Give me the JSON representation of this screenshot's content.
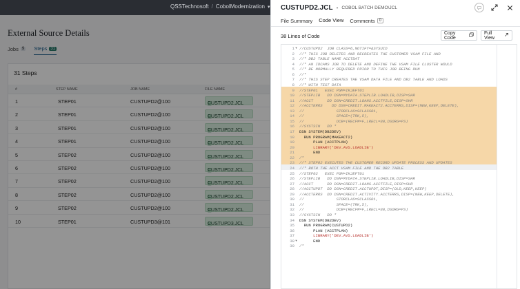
{
  "app": {
    "org": "QSSTechnosoft",
    "project": "CobolModernization"
  },
  "page": {
    "title": "External Source Details",
    "tabs": [
      {
        "label": "Jobs",
        "count": "9"
      },
      {
        "label": "Steps",
        "count": "31"
      }
    ],
    "steps_count_label": "31 Steps",
    "columns": [
      "#",
      "STEP NAME",
      "JOB NAME",
      "FILE NAME"
    ],
    "rows": [
      [
        "1",
        "STEP01",
        "CUSTUPD2@100",
        "CUSTUPD2.JCL"
      ],
      [
        "2",
        "STEP01",
        "CUSTUPD2@100",
        "CUSTUPD2.JCL"
      ],
      [
        "3",
        "STEP01",
        "CUSTUPD2@100",
        "CUSTUPD2.JCL"
      ],
      [
        "4",
        "STEP01",
        "CUSTUPD2@100",
        "CUSTUPD2.JCL"
      ],
      [
        "5",
        "STEP02",
        "CUSTUPD2@100",
        "CUSTUPD2.JCL"
      ],
      [
        "6",
        "STEP02",
        "CUSTUPD2@100",
        "CUSTUPD2.JCL"
      ],
      [
        "7",
        "STEP02",
        "CUSTUPD2@100",
        "CUSTUPD2.JCL"
      ],
      [
        "8",
        "STEP02",
        "CUSTUPD2@100",
        "CUSTUPD2.JCL"
      ],
      [
        "9",
        "STEP02",
        "CUSTUPD2@100",
        "CUSTUPD2.JCL"
      ],
      [
        "10",
        "STEP01",
        "CUSTUPD3@101",
        "CUSTUPD3.JCL"
      ]
    ]
  },
  "drawer": {
    "title": "CUSTUPD2.JCL",
    "subtitle": "COBOL BATCH DEMO\\JCL",
    "tabs": [
      {
        "label": "File Summary"
      },
      {
        "label": "Code View"
      },
      {
        "label": "Comments",
        "count": "0"
      }
    ],
    "lines_label": "38 Lines of Code",
    "copy_label": "Copy Code",
    "full_view_label": "Full View",
    "code_lines": [
      {
        "t": "//CUSTUPD2  JOB CLASS=6,NOTIFY=&SYSUID",
        "k": "comment"
      },
      {
        "t": "//* THIS JOB DELETES AND RECREATES THE CUSTOMER VSAM FILE AND",
        "k": "comment"
      },
      {
        "t": "//* DB2 TABLE NAME ACCTDAT",
        "k": "comment"
      },
      {
        "t": "//* AN IDCAMS JOB TO DELETE AND DEFINE THE VSAM FILE CLUSTER WOULD",
        "k": "comment"
      },
      {
        "t": "//* BE NORMALLY REQUIRED PRIOR TO THIS JOB BEING RUN",
        "k": "comment"
      },
      {
        "t": "//*",
        "k": "comment"
      },
      {
        "t": "//* THIS STEP CREATES THE VSAM DATA FILE AND DB2 TABLE AND LOADS",
        "k": "comment"
      },
      {
        "t": "//* WITH TEST DATA",
        "k": "comment"
      },
      {
        "t": "//STEP01   EXEC PGM=IKJEFT01",
        "k": "comment"
      },
      {
        "t": "//STEPLIB   DD DSN=MYDATA.STEPLIB.LOADLIB,DISP=SHR",
        "k": "comment"
      },
      {
        "t": "//ACCT      DD DSN=CREDIT.LOANS.ACCTFILE,DISP=SHR",
        "k": "comment"
      },
      {
        "t": "//ACCTERRS    DD DSN=CREDIT.MAKEACT2.ACCTERRS,DISP=(NEW,KEEP,DELETE),",
        "k": "comment"
      },
      {
        "t": "//              STORCLAS=SCLASS01,",
        "k": "comment"
      },
      {
        "t": "//              SPACE=(TRK,5),",
        "k": "comment"
      },
      {
        "t": "//              DCB=(RECFM=F,LRECL=80,DSORG=PS)",
        "k": "comment"
      },
      {
        "t": "//SYSTSIN   DD *",
        "k": "comment"
      },
      {
        "t": "DSN SYSTEM(DB2DEV)",
        "k": "code"
      },
      {
        "t": "  RUN PROGRAM(MAKEACT2)",
        "k": "code"
      },
      {
        "t": "      PLAN (ACCTPLAN)",
        "k": "code"
      },
      {
        "t": "      LIBRARY('DEV.AVS.LOADLIB')",
        "k": "str"
      },
      {
        "t": "      END",
        "k": "code"
      },
      {
        "t": "/*",
        "k": "comment"
      },
      {
        "t": "//* STEP02 EXECUTES THE CUSTOMER RECORD UPDATE PROCESS AND UPDATES",
        "k": "comment"
      },
      {
        "t": "//* BOTH THE ACCT VSAM FILE AND THE DB2 TABLE",
        "k": "comment"
      },
      {
        "t": "//STEP02   EXEC PGM=IKJEFT01",
        "k": "comment"
      },
      {
        "t": "//STEPLIB   DD DSN=MYDATA.STEPLIB.LOADLIB,DISP=SHR",
        "k": "comment"
      },
      {
        "t": "//ACCT      DD DSN=CREDIT.LOANS.ACCTFILE,DISP=SHR",
        "k": "comment"
      },
      {
        "t": "//ACCTUPDT  DD DSN=CREDIT.ACCTUPDT,DISP=(OLD,KEEP,KEEP)",
        "k": "comment"
      },
      {
        "t": "//ACCTERRS  DD DSN=CREDIT.ACTIVITY.ACCTERRS,DISP=(NEW,KEEP,DELETE),",
        "k": "comment"
      },
      {
        "t": "//              STORCLAS=SCLASS01,",
        "k": "comment"
      },
      {
        "t": "//              SPACE=(TRK,5),",
        "k": "comment"
      },
      {
        "t": "//              DCB=(RECFM=F,LRECL=80,DSORG=PS)",
        "k": "comment"
      },
      {
        "t": "//SYSTSIN   DD *",
        "k": "comment"
      },
      {
        "t": "DSN SYSTEM(DB2DEV)",
        "k": "code"
      },
      {
        "t": "  RUN PROGRAM(CUSTUPD2)",
        "k": "code"
      },
      {
        "t": "      PLAN (ACCTPLAN)",
        "k": "code"
      },
      {
        "t": "      LIBRARY('DEV.AVS.LOADLIB')",
        "k": "str"
      },
      {
        "t": "      END",
        "k": "code"
      },
      {
        "t": "/*",
        "k": "comment"
      }
    ],
    "highlighted_range": [
      9,
      23
    ],
    "current_line": 24,
    "fold_markers": [
      1,
      38
    ]
  },
  "icons": {
    "file": "file-icon",
    "copy": "copy-icon",
    "external": "external-link-icon",
    "chat": "chat-icon",
    "expand": "expand-icon",
    "close": "close-icon",
    "chevron": "chevron-down-icon"
  },
  "colors": {
    "highlight": "#f6d7a8",
    "accent": "#1a5d8a",
    "file_chip": "#d9efe0"
  }
}
